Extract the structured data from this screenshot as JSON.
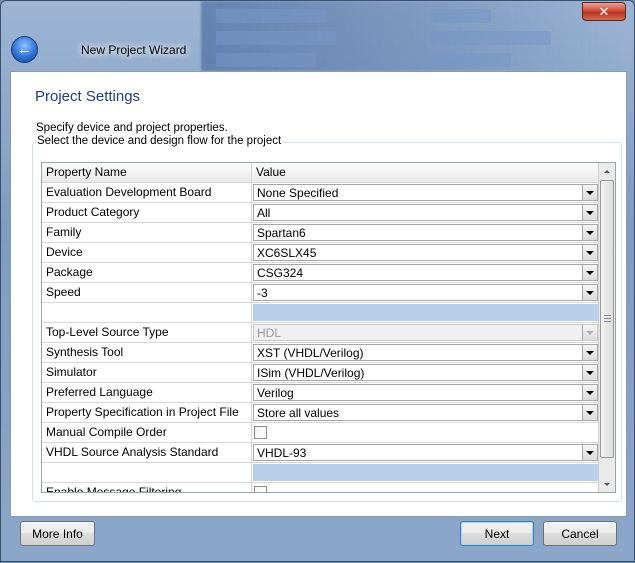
{
  "window": {
    "title": "New Project Wizard",
    "close_glyph": "✕",
    "back_glyph": "←"
  },
  "page": {
    "heading": "Project Settings",
    "description": "Specify device and project properties.",
    "group_label": "Select the device and design flow for the project"
  },
  "grid": {
    "columns": [
      "Property Name",
      "Value"
    ],
    "rows": [
      {
        "name": "Evaluation Development Board",
        "value": "None Specified",
        "kind": "dropdown"
      },
      {
        "name": "Product Category",
        "value": "All",
        "kind": "dropdown"
      },
      {
        "name": "Family",
        "value": "Spartan6",
        "kind": "dropdown"
      },
      {
        "name": "Device",
        "value": "XC6SLX45",
        "kind": "dropdown"
      },
      {
        "name": "Package",
        "value": "CSG324",
        "kind": "dropdown"
      },
      {
        "name": "Speed",
        "value": "-3",
        "kind": "dropdown"
      },
      {
        "name": "",
        "value": "",
        "kind": "separator"
      },
      {
        "name": "Top-Level Source Type",
        "value": "HDL",
        "kind": "dropdown-disabled"
      },
      {
        "name": "Synthesis Tool",
        "value": "XST (VHDL/Verilog)",
        "kind": "dropdown"
      },
      {
        "name": "Simulator",
        "value": "ISim (VHDL/Verilog)",
        "kind": "dropdown"
      },
      {
        "name": "Preferred Language",
        "value": "Verilog",
        "kind": "dropdown"
      },
      {
        "name": "Property Specification in Project File",
        "value": "Store all values",
        "kind": "dropdown"
      },
      {
        "name": "Manual Compile Order",
        "value": "",
        "kind": "checkbox"
      },
      {
        "name": "VHDL Source Analysis Standard",
        "value": "VHDL-93",
        "kind": "dropdown"
      },
      {
        "name": "",
        "value": "",
        "kind": "separator"
      },
      {
        "name": "Enable Message Filtering",
        "value": "",
        "kind": "checkbox"
      }
    ]
  },
  "buttons": {
    "more_info": "More Info",
    "next": "Next",
    "cancel": "Cancel"
  },
  "colors": {
    "heading": "#1f3d8a",
    "separator_fill": "#b8d0ea",
    "default_button_border": "#3c7fb1"
  }
}
